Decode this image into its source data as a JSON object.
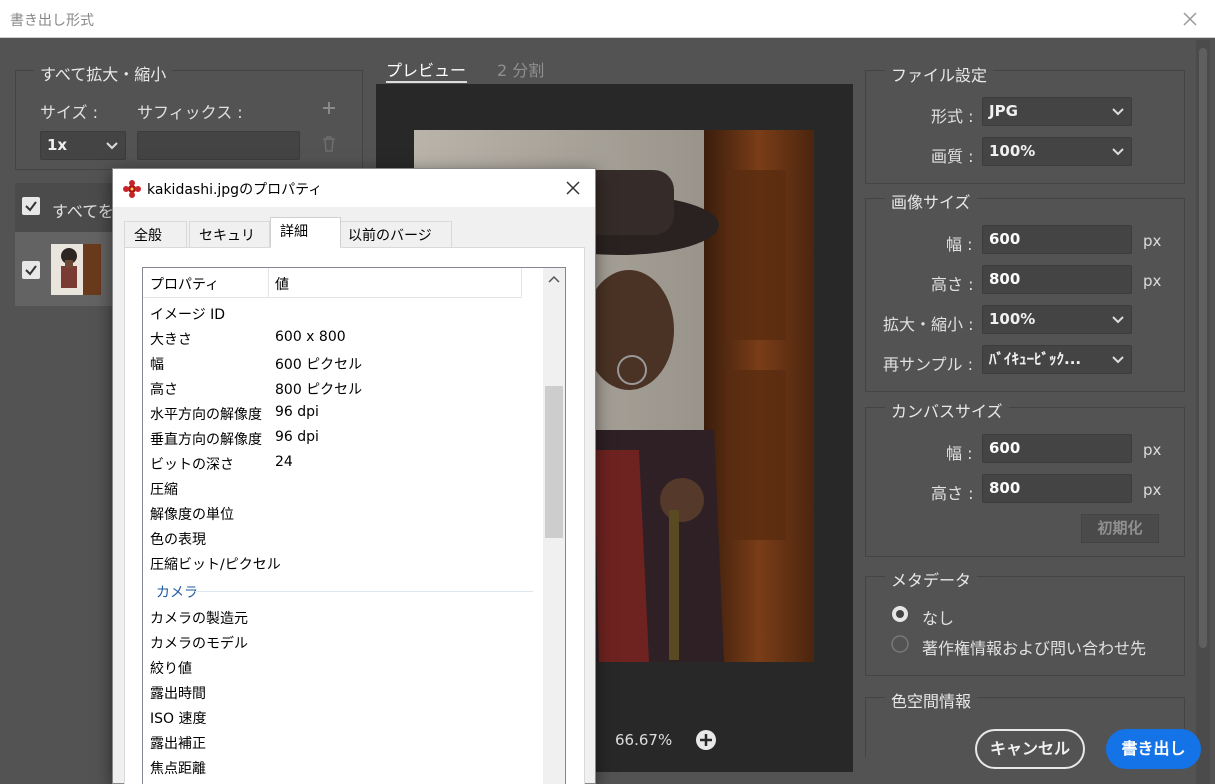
{
  "window": {
    "title": "書き出し形式"
  },
  "scale_all": {
    "legend": "すべて拡大・縮小",
    "size_label": "サイズ :",
    "suffix_label": "サフィックス :",
    "size_value": "1x",
    "suffix_value": ""
  },
  "list": {
    "select_all_label": "すべてを"
  },
  "preview": {
    "tab_preview": "プレビュー",
    "tab_split": "2 分割",
    "zoom": "66.67%"
  },
  "file_settings": {
    "legend": "ファイル設定",
    "format_label": "形式 :",
    "format_value": "JPG",
    "quality_label": "画質 :",
    "quality_value": "100%"
  },
  "image_size": {
    "legend": "画像サイズ",
    "width_label": "幅 :",
    "width_value": "600",
    "height_label": "高さ :",
    "height_value": "800",
    "scale_label": "拡大・縮小 :",
    "scale_value": "100%",
    "resample_label": "再サンプル :",
    "resample_value": "ﾊﾞｲｷｭｰﾋﾞｯｸ...",
    "unit": "px"
  },
  "canvas_size": {
    "legend": "カンバスサイズ",
    "width_label": "幅 :",
    "width_value": "600",
    "height_label": "高さ :",
    "height_value": "800",
    "unit": "px",
    "reset_label": "初期化"
  },
  "metadata": {
    "legend": "メタデータ",
    "option_none": "なし",
    "option_copyright": "著作権情報および問い合わせ先",
    "selected": "なし"
  },
  "color_space": {
    "legend": "色空間情報"
  },
  "buttons": {
    "cancel": "キャンセル",
    "export": "書き出し"
  },
  "properties_dialog": {
    "title": "kakidashi.jpgのプロパティ",
    "tabs": [
      {
        "label": "全般"
      },
      {
        "label": "セキュリティ"
      },
      {
        "label": "詳細"
      },
      {
        "label": "以前のバージョン"
      }
    ],
    "active_tab": "詳細",
    "col_property": "プロパティ",
    "col_value": "値",
    "rows": [
      {
        "name": "イメージ ID",
        "value": ""
      },
      {
        "name": "大きさ",
        "value": "600 x 800"
      },
      {
        "name": "幅",
        "value": "600 ピクセル"
      },
      {
        "name": "高さ",
        "value": "800 ピクセル"
      },
      {
        "name": "水平方向の解像度",
        "value": "96 dpi"
      },
      {
        "name": "垂直方向の解像度",
        "value": "96 dpi"
      },
      {
        "name": "ビットの深さ",
        "value": "24"
      },
      {
        "name": "圧縮",
        "value": ""
      },
      {
        "name": "解像度の単位",
        "value": ""
      },
      {
        "name": "色の表現",
        "value": ""
      },
      {
        "name": "圧縮ビット/ピクセル",
        "value": ""
      }
    ],
    "section_camera": "カメラ",
    "camera_rows": [
      {
        "name": "カメラの製造元"
      },
      {
        "name": "カメラのモデル"
      },
      {
        "name": "絞り値"
      },
      {
        "name": "露出時間"
      },
      {
        "name": "ISO 速度"
      },
      {
        "name": "露出補正"
      },
      {
        "name": "焦点距離"
      }
    ]
  }
}
